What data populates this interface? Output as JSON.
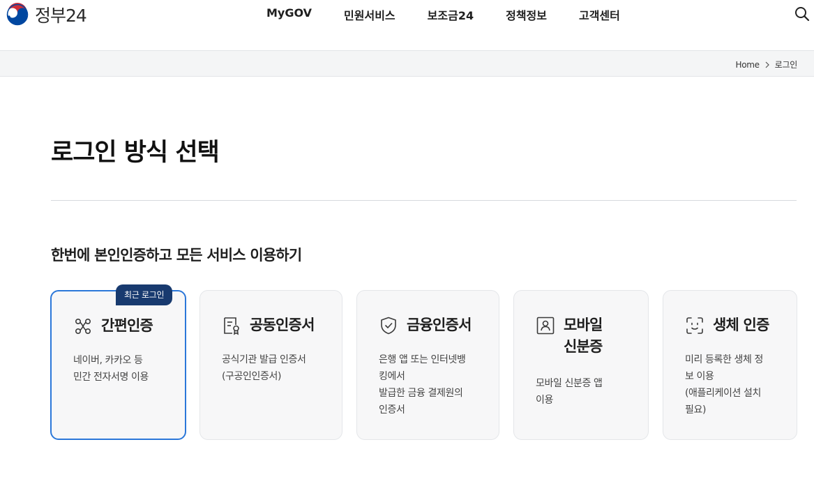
{
  "header": {
    "logo_text": "정부24",
    "nav": [
      "MyGOV",
      "민원서비스",
      "보조금24",
      "정책정보",
      "고객센터"
    ],
    "search_icon": "search-icon"
  },
  "breadcrumb": {
    "home": "Home",
    "current": "로그인"
  },
  "page": {
    "title": "로그인 방식 선택",
    "section_title": "한번에 본인인증하고 모든 서비스 이용하기"
  },
  "cards": [
    {
      "title": "간편인증",
      "icon": "link-nodes-icon",
      "badge": "최근 로그인",
      "desc": [
        "네이버, 카카오 등",
        "민간 전자서명 이용"
      ],
      "selected": true
    },
    {
      "title": "공동인증서",
      "icon": "certificate-icon",
      "desc": [
        "공식기관 발급 인증서",
        "(구공인인증서)"
      ]
    },
    {
      "title": "금융인증서",
      "icon": "shield-check-icon",
      "desc": [
        "은행 앱 또는 인터넷뱅",
        "킹에서",
        "발급한 금융 결제원의",
        "인증서"
      ]
    },
    {
      "title_lines": [
        "모바일",
        "신분증"
      ],
      "icon": "id-card-icon",
      "desc": [
        "모바일 신분증 앱",
        "이용"
      ]
    },
    {
      "title": "생체 인증",
      "icon": "face-scan-icon",
      "desc": [
        "미리 등록한 생체 정",
        "보 이용",
        "(애플리케이션 설치",
        "필요)"
      ]
    }
  ],
  "colors": {
    "accent_border": "#2b77d9",
    "badge_bg": "#183a6f",
    "card_bg": "#f7f7f8"
  }
}
